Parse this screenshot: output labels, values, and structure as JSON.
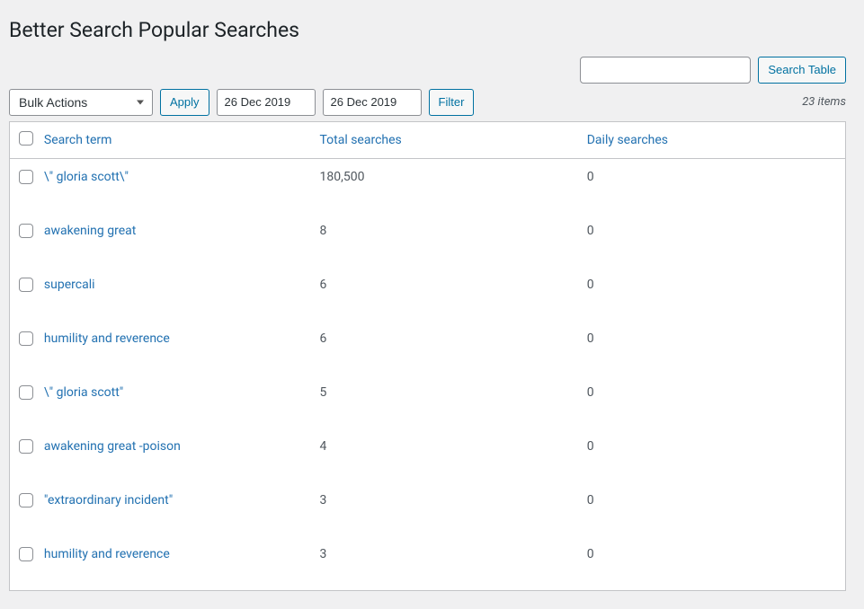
{
  "page_title": "Better Search Popular Searches",
  "search": {
    "value": "",
    "button": "Search Table"
  },
  "bulk": {
    "selected": "Bulk Actions",
    "apply": "Apply"
  },
  "dates": {
    "from": "26 Dec 2019",
    "to": "26 Dec 2019",
    "filter": "Filter"
  },
  "items_count": "23 items",
  "columns": {
    "term": "Search term",
    "total": "Total searches",
    "daily": "Daily searches"
  },
  "rows": [
    {
      "term": "\\\" gloria scott\\\"",
      "total": "180,500",
      "daily": "0"
    },
    {
      "term": "awakening great",
      "total": "8",
      "daily": "0"
    },
    {
      "term": "supercali",
      "total": "6",
      "daily": "0"
    },
    {
      "term": "humility and reverence",
      "total": "6",
      "daily": "0"
    },
    {
      "term": "\\\" gloria scott\"",
      "total": "5",
      "daily": "0"
    },
    {
      "term": "awakening great -poison",
      "total": "4",
      "daily": "0"
    },
    {
      "term": "\"extraordinary incident\"",
      "total": "3",
      "daily": "0"
    },
    {
      "term": "humility and reverence",
      "total": "3",
      "daily": "0"
    }
  ]
}
